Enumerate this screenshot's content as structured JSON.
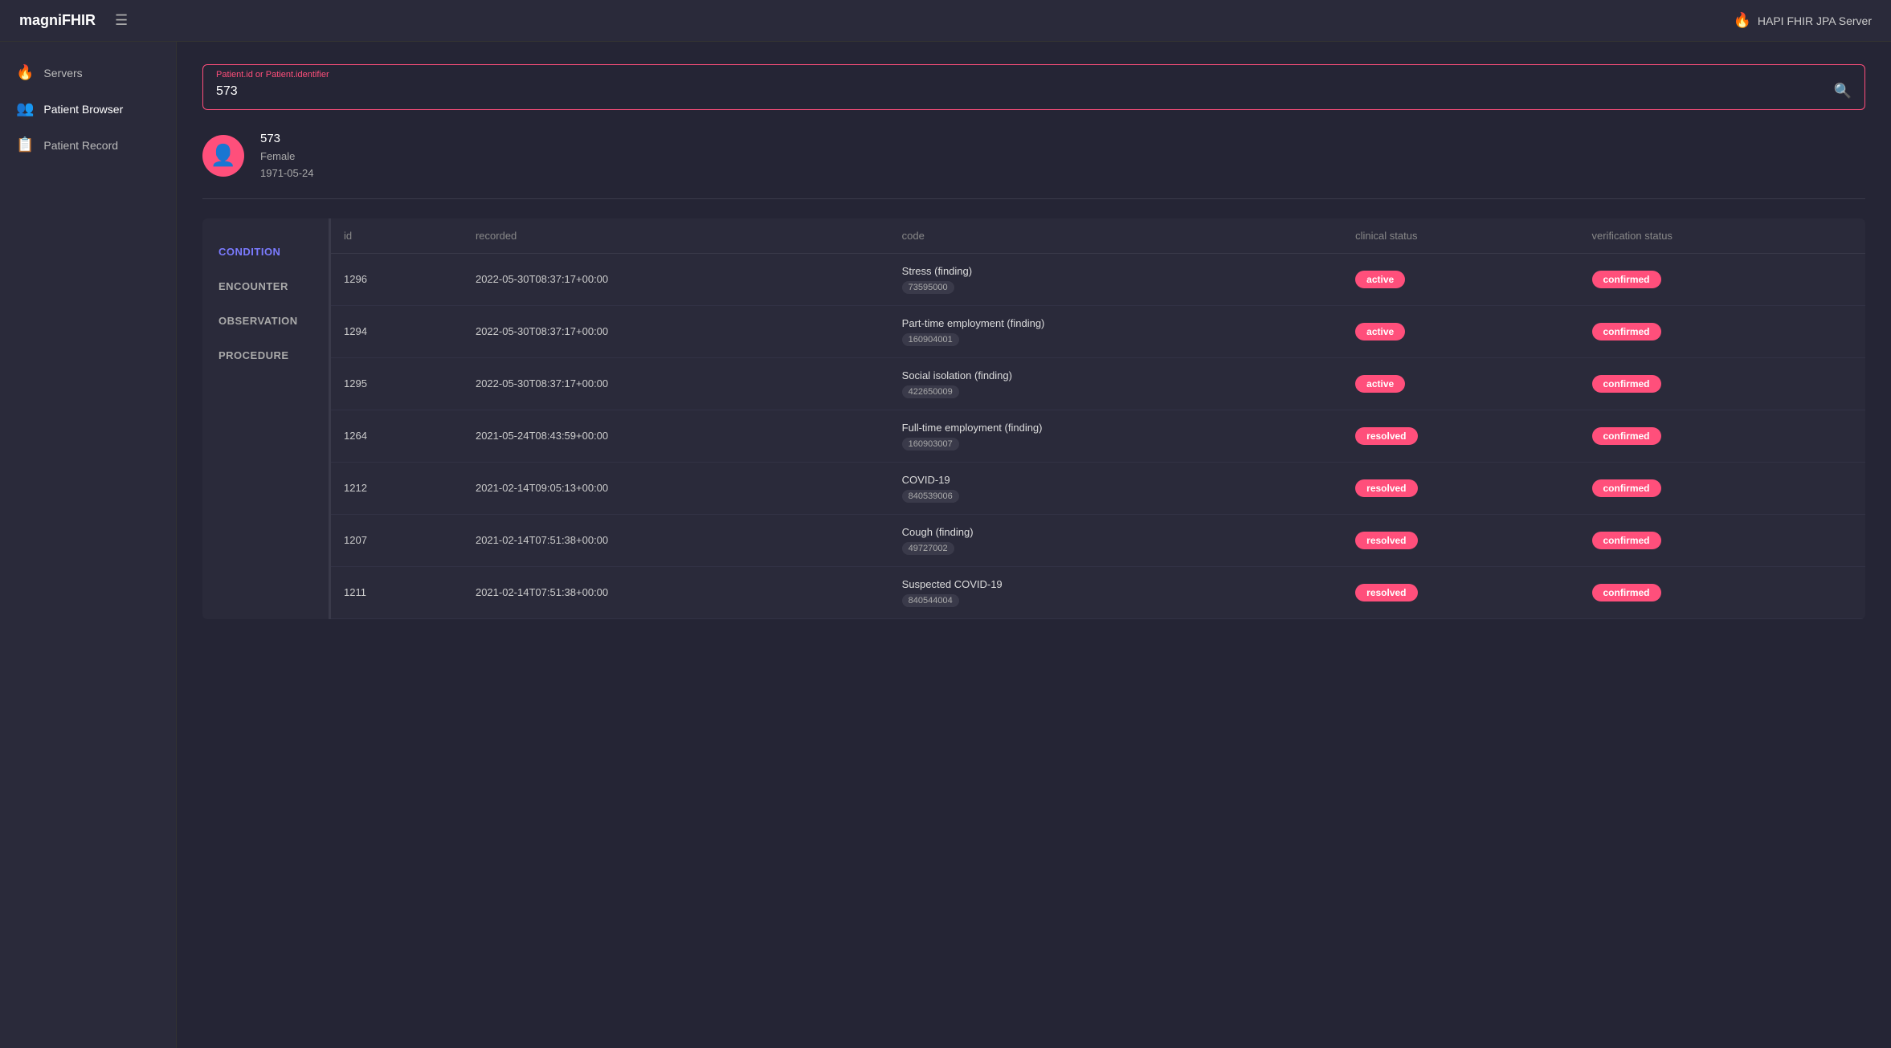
{
  "app": {
    "title": "magniFHIR",
    "server_label": "HAPI FHIR JPA Server"
  },
  "sidebar": {
    "items": [
      {
        "id": "servers",
        "label": "Servers",
        "icon": "🔥"
      },
      {
        "id": "patient-browser",
        "label": "Patient Browser",
        "icon": "👥",
        "active": true
      },
      {
        "id": "patient-record",
        "label": "Patient Record",
        "icon": "📋"
      }
    ]
  },
  "search": {
    "label": "Patient.id or Patient.identifier",
    "value": "573",
    "placeholder": "Patient.id or Patient.identifier"
  },
  "patient": {
    "id": "573",
    "gender": "Female",
    "dob": "1971-05-24"
  },
  "left_nav": {
    "items": [
      {
        "id": "condition",
        "label": "CONDITION",
        "active": true
      },
      {
        "id": "encounter",
        "label": "ENCOUNTER"
      },
      {
        "id": "observation",
        "label": "OBSERVATION"
      },
      {
        "id": "procedure",
        "label": "PROCEDURE"
      }
    ]
  },
  "table": {
    "columns": [
      {
        "id": "id",
        "label": "id"
      },
      {
        "id": "recorded",
        "label": "recorded"
      },
      {
        "id": "code",
        "label": "code"
      },
      {
        "id": "clinical_status",
        "label": "clinical status"
      },
      {
        "id": "verification_status",
        "label": "verification status"
      }
    ],
    "rows": [
      {
        "id": "1296",
        "recorded": "2022-05-30T08:37:17+00:00",
        "code_name": "Stress (finding)",
        "code_num": "73595000",
        "clinical_status": "active",
        "clinical_status_class": "badge-active",
        "verification_status": "confirmed",
        "verification_status_class": "badge-confirmed"
      },
      {
        "id": "1294",
        "recorded": "2022-05-30T08:37:17+00:00",
        "code_name": "Part-time employment (finding)",
        "code_num": "160904001",
        "clinical_status": "active",
        "clinical_status_class": "badge-active",
        "verification_status": "confirmed",
        "verification_status_class": "badge-confirmed"
      },
      {
        "id": "1295",
        "recorded": "2022-05-30T08:37:17+00:00",
        "code_name": "Social isolation (finding)",
        "code_num": "422650009",
        "clinical_status": "active",
        "clinical_status_class": "badge-active",
        "verification_status": "confirmed",
        "verification_status_class": "badge-confirmed"
      },
      {
        "id": "1264",
        "recorded": "2021-05-24T08:43:59+00:00",
        "code_name": "Full-time employment (finding)",
        "code_num": "160903007",
        "clinical_status": "resolved",
        "clinical_status_class": "badge-resolved",
        "verification_status": "confirmed",
        "verification_status_class": "badge-confirmed"
      },
      {
        "id": "1212",
        "recorded": "2021-02-14T09:05:13+00:00",
        "code_name": "COVID-19",
        "code_num": "840539006",
        "clinical_status": "resolved",
        "clinical_status_class": "badge-resolved",
        "verification_status": "confirmed",
        "verification_status_class": "badge-confirmed"
      },
      {
        "id": "1207",
        "recorded": "2021-02-14T07:51:38+00:00",
        "code_name": "Cough (finding)",
        "code_num": "49727002",
        "clinical_status": "resolved",
        "clinical_status_class": "badge-resolved",
        "verification_status": "confirmed",
        "verification_status_class": "badge-confirmed"
      },
      {
        "id": "1211",
        "recorded": "2021-02-14T07:51:38+00:00",
        "code_name": "Suspected COVID-19",
        "code_num": "840544004",
        "clinical_status": "resolved",
        "clinical_status_class": "badge-resolved",
        "verification_status": "confirmed",
        "verification_status_class": "badge-confirmed"
      }
    ]
  }
}
